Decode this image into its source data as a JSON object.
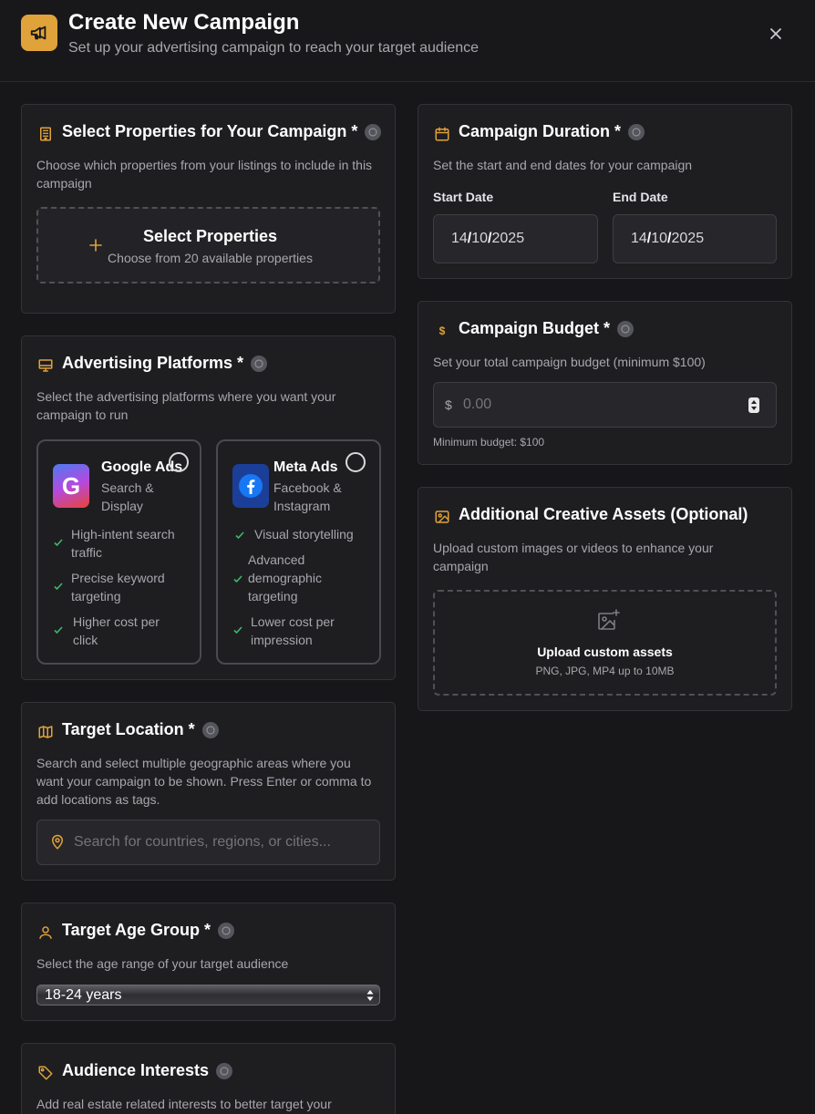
{
  "header": {
    "title": "Create New Campaign",
    "subtitle": "Set up your advertising campaign to reach your target audience",
    "accent": "#e0a23a"
  },
  "properties": {
    "title": "Select Properties for Your Campaign *",
    "description": "Choose which properties from your listings to include in this campaign",
    "button_title": "Select Properties",
    "button_subtitle": "Choose from 20 available properties"
  },
  "platforms": {
    "title": "Advertising Platforms *",
    "description": "Select the advertising platforms where you want your campaign to run",
    "items": [
      {
        "name": "Google Ads",
        "subtitle": "Search & Display",
        "features": [
          "High-intent search traffic",
          "Precise keyword targeting",
          "Higher cost per click"
        ]
      },
      {
        "name": "Meta Ads",
        "subtitle": "Facebook & Instagram",
        "features": [
          "Visual storytelling",
          "Advanced demographic targeting",
          "Lower cost per impression"
        ]
      }
    ]
  },
  "location": {
    "title": "Target Location *",
    "description": "Search and select multiple geographic areas where you want your campaign to be shown. Press Enter or comma to add locations as tags.",
    "placeholder": "Search for countries, regions, or cities..."
  },
  "age": {
    "title": "Target Age Group *",
    "description": "Select the age range of your target audience",
    "selected": "18-24 years"
  },
  "interests": {
    "title": "Audience Interests",
    "description": "Add real estate related interests to better target your"
  },
  "duration": {
    "title": "Campaign Duration *",
    "description": "Set the start and end dates for your campaign",
    "start_label": "Start Date",
    "end_label": "End Date",
    "start": {
      "day": "14",
      "month": "10",
      "year": "2025"
    },
    "end": {
      "day": "14",
      "month": "10",
      "year": "2025"
    }
  },
  "budget": {
    "title": "Campaign Budget *",
    "description": "Set your total campaign budget (minimum $100)",
    "currency": "$",
    "placeholder": "0.00",
    "hint": "Minimum budget: $100"
  },
  "assets": {
    "title": "Additional Creative Assets (Optional)",
    "description": "Upload custom images or videos to enhance your campaign",
    "upload_title": "Upload custom assets",
    "upload_hint": "PNG, JPG, MP4 up to 10MB"
  }
}
